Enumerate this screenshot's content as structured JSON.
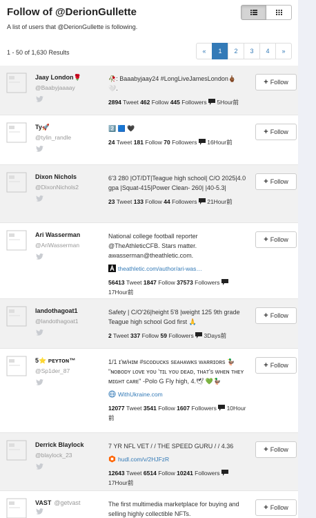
{
  "page": {
    "title": "Follow of @DerionGullette",
    "subtitle": "A list of users that @DerionGullette is following.",
    "results": "1 - 50 of 1,630 Results"
  },
  "view_toggle": {
    "list_icon": "list-icon",
    "grid_icon": "grid-icon",
    "active": "list"
  },
  "pagination": {
    "prev": "«",
    "pages": [
      "1",
      "2",
      "3",
      "4"
    ],
    "active": "1",
    "next": "»"
  },
  "follow_label": "Follow",
  "labels": {
    "tweet": "Tweet",
    "follow": "Follow",
    "followers": "Followers"
  },
  "users": [
    {
      "name": "Jaay London🌹",
      "handle": "@Baabyjaaaay",
      "bio": "🥀: Baaabyjaay24 #LongLiveJamesLondon🖕🏾 🤍.",
      "tweets": "2894",
      "following": "462",
      "followers": "445",
      "time": "5Hour前"
    },
    {
      "name": "Ty🚀",
      "handle": "@tylin_randle",
      "bio": "2️⃣ 🟦 🖤",
      "tweets": "24",
      "following": "181",
      "followers": "70",
      "time": "16Hour前"
    },
    {
      "name": "Dixon Nichols",
      "handle": "@DixonNichols2",
      "bio": "6'3 280 |OT/DT|Teague high school| C/O 2025|4.0 gpa |Squat-415|Power Clean- 260| |40-5.3|",
      "tweets": "23",
      "following": "133",
      "followers": "44",
      "time": "21Hour前"
    },
    {
      "name": "Ari Wasserman",
      "handle": "@AriWasserman",
      "bio": "National college football reporter @TheAthleticCFB. Stars matter. awasserman@theathletic.com.",
      "link": "theathletic.com/author/ari-was…",
      "link_icon": "athletic-logo-icon",
      "tweets": "56413",
      "following": "1847",
      "followers": "37573",
      "time": "17Hour前"
    },
    {
      "name": "landothagoat1",
      "handle": "@landothagoat1",
      "bio": "Safety | C/O'26|height 5'8 |weight 125 9th grade Teague high school God first 🙏",
      "tweets": "2",
      "following": "337",
      "followers": "59",
      "time": "3Days前"
    },
    {
      "name": "5⭐ ᴘᴇʏᴛᴏɴ™",
      "handle": "@Sp1der_87",
      "bio": "1/1 ɪ'ᴍ/ʜɪᴍ #sᴄᴏᴅᴜᴄᴋs sᴇᴀʜᴀᴡᴋs ᴡᴀʀʀɪᴏʀs 🦆 \"ɴᴏʙᴏᴅʏ ʟᴏᴠᴇ ʏᴏᴜ 'ᴛɪʟ ʏᴏᴜ ᴅᴇᴀᴅ, ᴛʜᴀᴛ's ᴡʜᴇɴ ᴛʜᴇʏ ᴍɪɢʜᴛ ᴄᴀʀᴇ\" -Polo G Fly high, 4.🕊 💚🦆",
      "link": "WithUkraine.com",
      "link_icon": "globe-icon",
      "tweets": "12077",
      "following": "3541",
      "followers": "1607",
      "time": "10Hour前"
    },
    {
      "name": "Derrick Blaylock",
      "handle": "@blaylock_23",
      "bio": "7 YR NFL VET / / THE SPEED GURU / / 4.36",
      "link": "hudl.com/v/2HJFzR",
      "link_icon": "hudl-icon",
      "tweets": "12643",
      "following": "6514",
      "followers": "10241",
      "time": "17Hour前"
    },
    {
      "name": "VAST",
      "handle": "@getvast",
      "bio": "The first multimedia marketplace for buying and selling highly collectible NFTs.",
      "tweets": "",
      "following": "",
      "followers": "",
      "time": ""
    }
  ]
}
